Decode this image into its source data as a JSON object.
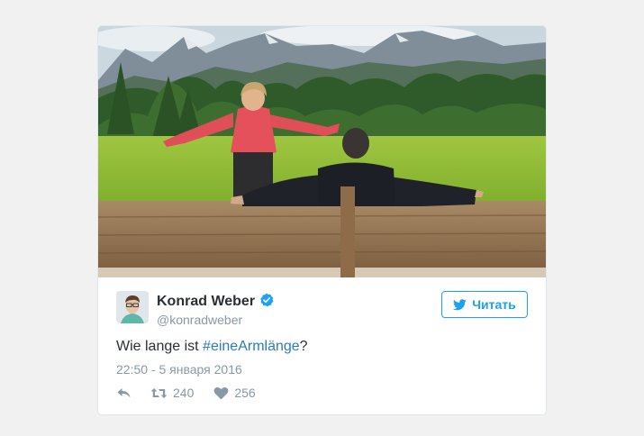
{
  "tweet": {
    "author_name": "Konrad Weber",
    "author_handle": "@konradweber",
    "follow_label": "Читать",
    "text_before": "Wie lange ist ",
    "hashtag": "#eineArmlänge",
    "text_after": "?",
    "timestamp": "22:50 - 5 января 2016",
    "retweets": "240",
    "likes": "256"
  },
  "colors": {
    "accent": "#1da1f2",
    "hashtag": "#2b7bb9",
    "muted": "#8899a6",
    "text": "#292f33"
  },
  "icons": [
    "verified-badge-icon",
    "twitter-bird-icon",
    "reply-icon",
    "retweet-icon",
    "heart-icon"
  ]
}
